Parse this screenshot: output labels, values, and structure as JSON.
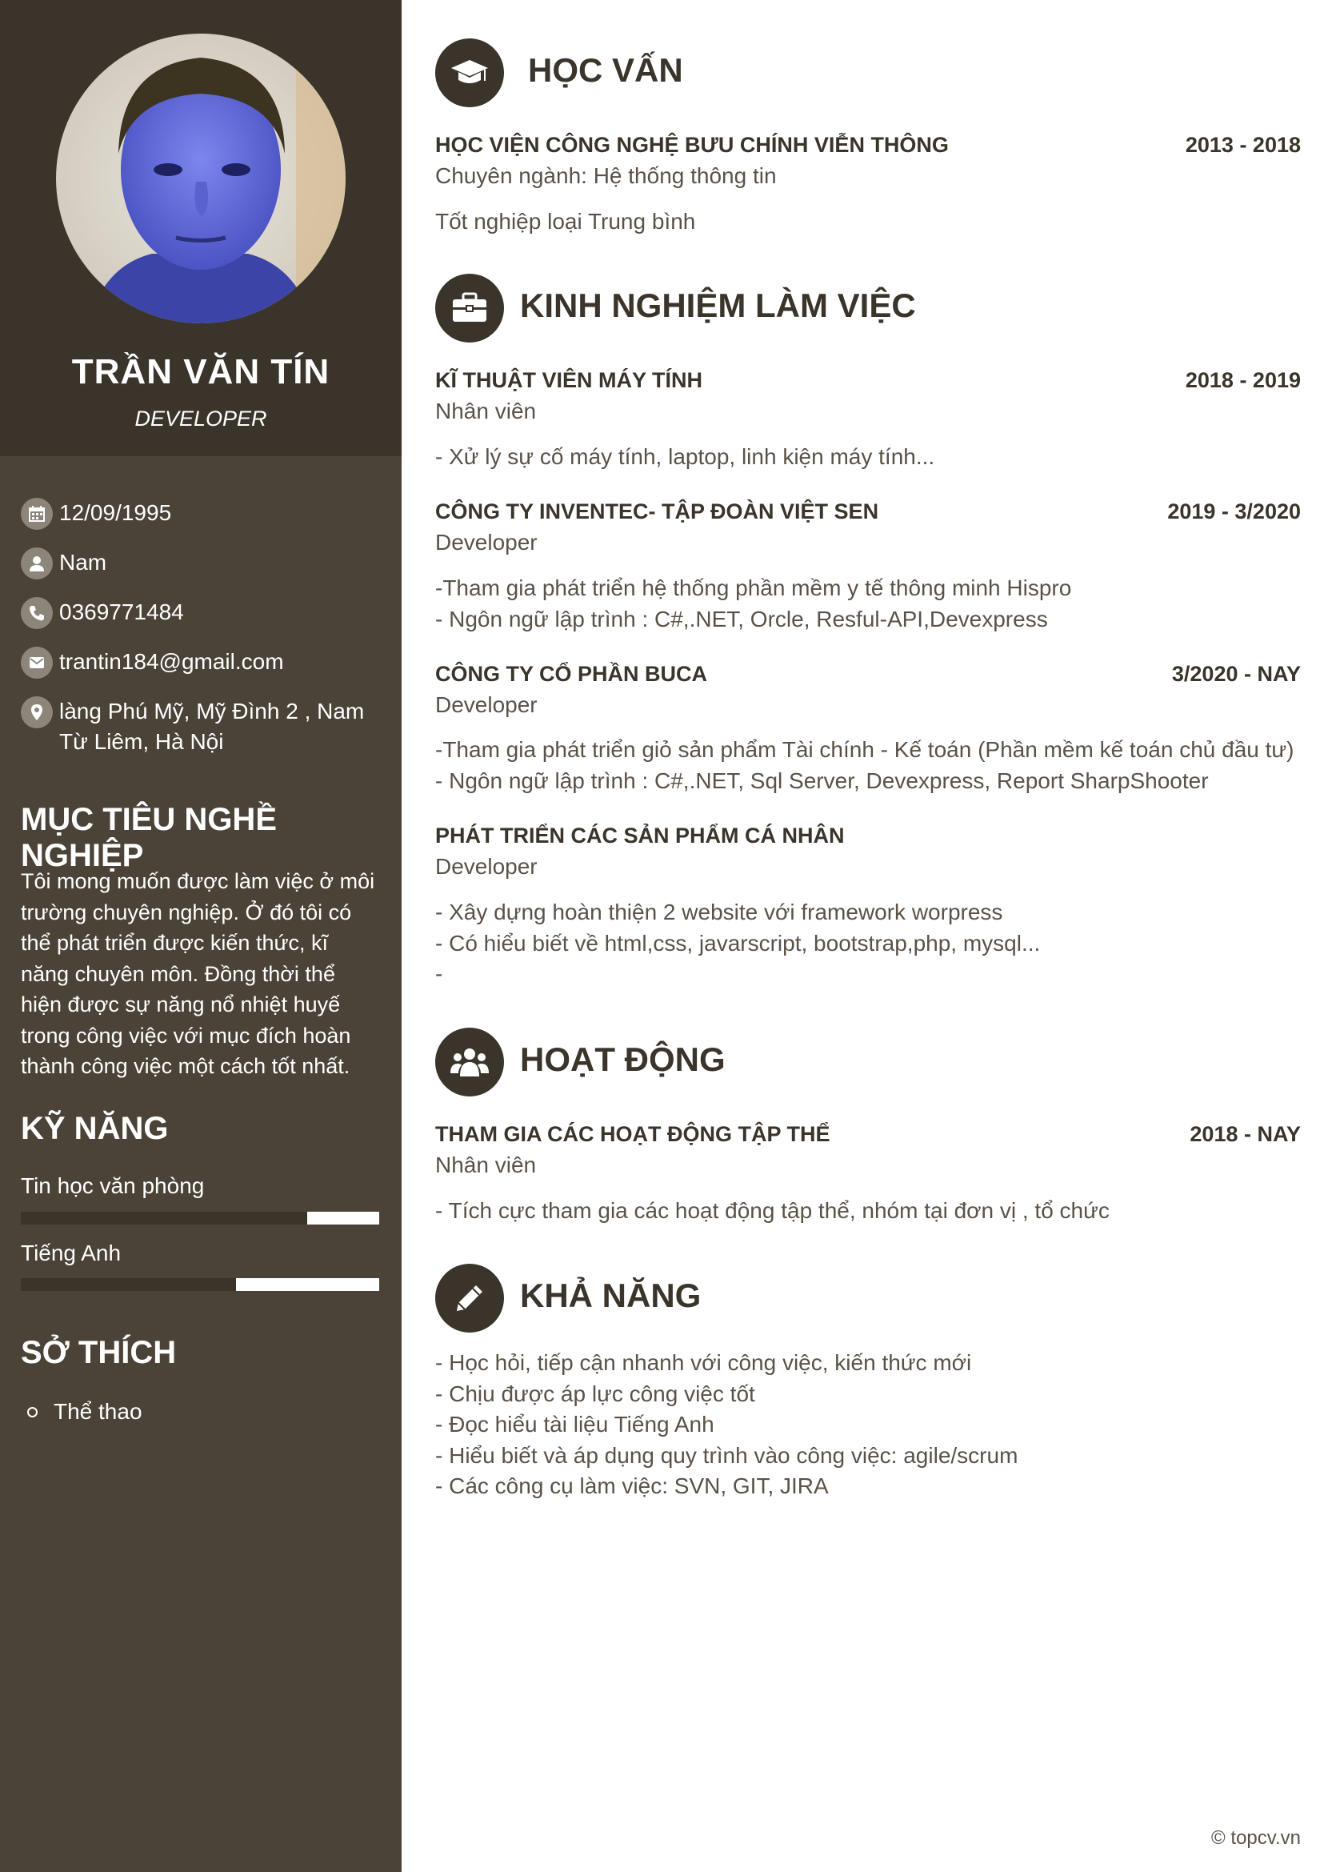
{
  "profile": {
    "name": "TRẦN VĂN TÍN",
    "role": "DEVELOPER"
  },
  "contact": {
    "birthday": "12/09/1995",
    "gender": "Nam",
    "phone": "0369771484",
    "email": "trantin184@gmail.com",
    "address": "làng Phú Mỹ, Mỹ Đình 2 , Nam Từ Liêm, Hà Nội"
  },
  "objective": {
    "heading": "MỤC TIÊU NGHỀ NGHIỆP",
    "text": "Tôi mong muốn được làm việc ở môi trường chuyên nghiệp. Ở đó tôi có thể phát triển được kiến thức, kĩ năng chuyên môn. Đồng thời thể hiện được sự năng nổ nhiệt huyế trong công việc với mục đích hoàn thành công việc một cách tốt nhất."
  },
  "skills": {
    "heading": "KỸ NĂNG",
    "items": [
      {
        "label": "Tin học văn phòng",
        "level": 0.8
      },
      {
        "label": "Tiếng Anh",
        "level": 0.6
      }
    ]
  },
  "hobbies": {
    "heading": "SỞ THÍCH",
    "items": [
      "Thể thao"
    ]
  },
  "education": {
    "heading": "HỌC VẤN",
    "icon": "graduation-cap-icon",
    "entries": [
      {
        "title": "HỌC VIỆN CÔNG NGHỆ BƯU CHÍNH VIỄN THÔNG",
        "date": "2013 - 2018",
        "sub": "Chuyên ngành: Hệ thống thông tin",
        "desc": [
          "Tốt nghiệp loại Trung bình"
        ]
      }
    ]
  },
  "experience": {
    "heading": "KINH NGHIỆM LÀM VIỆC",
    "icon": "briefcase-icon",
    "entries": [
      {
        "title": "KĨ THUẬT VIÊN MÁY TÍNH",
        "date": "2018 - 2019",
        "sub": "Nhân viên",
        "desc": [
          "- Xử lý sự cố máy tính, laptop, linh kiện máy tính..."
        ]
      },
      {
        "title": "CÔNG TY INVENTEC- TẬP ĐOÀN VIỆT SEN",
        "date": "2019 - 3/2020",
        "sub": "Developer",
        "desc": [
          "-Tham gia phát triển hệ thống phần mềm y tế thông minh Hispro",
          "- Ngôn ngữ lập trình : C#,.NET, Orcle, Resful-API,Devexpress"
        ]
      },
      {
        "title": "CÔNG TY CỔ PHẦN BUCA",
        "date": "3/2020 - NAY",
        "sub": "Developer",
        "desc": [
          "-Tham gia phát triển giỏ sản phẩm Tài chính - Kế toán (Phần mềm kế toán chủ đầu tư)",
          "- Ngôn ngữ lập trình : C#,.NET, Sql Server, Devexpress, Report SharpShooter"
        ]
      },
      {
        "title": "PHÁT TRIỂN CÁC SẢN PHẨM CÁ NHÂN",
        "date": "",
        "sub": "Developer",
        "desc": [
          "- Xây dựng hoàn thiện 2 website với framework worpress",
          "- Có hiểu biết về html,css, javarscript, bootstrap,php, mysql...",
          "-"
        ]
      }
    ]
  },
  "activities": {
    "heading": "HOẠT ĐỘNG",
    "icon": "group-icon",
    "entries": [
      {
        "title": "THAM GIA CÁC HOẠT ĐỘNG TẬP THỂ",
        "date": "2018 - NAY",
        "sub": "Nhân viên",
        "desc": [
          "- Tích cực tham gia các hoạt động tập thể, nhóm tại đơn vị , tổ chức"
        ]
      }
    ]
  },
  "abilities": {
    "heading": "KHẢ NĂNG",
    "icon": "pencil-icon",
    "items": [
      "- Học hỏi, tiếp cận nhanh với công việc, kiến thức mới",
      "- Chịu được áp lực công việc tốt",
      "- Đọc hiểu tài liệu Tiếng Anh",
      "- Hiểu biết và áp dụng quy trình vào công việc: agile/scrum",
      "- Các công cụ làm việc: SVN, GIT, JIRA"
    ]
  },
  "footer": {
    "copyright": "© topcv.vn"
  }
}
